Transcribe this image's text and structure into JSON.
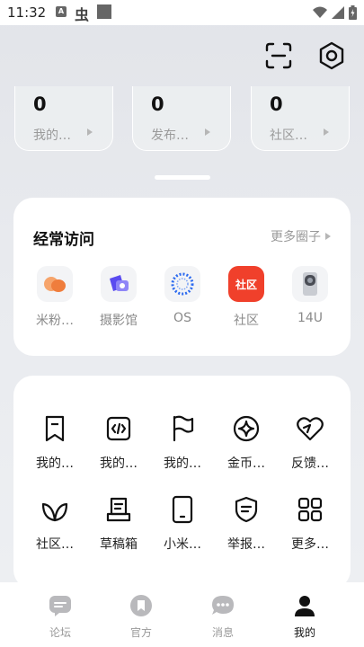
{
  "status_bar": {
    "time": "11:32",
    "badge": "A",
    "app_glyph": "虫"
  },
  "stats": [
    {
      "value": "0",
      "label": "我的…"
    },
    {
      "value": "0",
      "label": "发布…"
    },
    {
      "value": "0",
      "label": "社区…"
    }
  ],
  "frequent": {
    "title": "经常访问",
    "more": "更多圈子",
    "apps": [
      {
        "label": "米粉…",
        "icon": "fan-club-icon"
      },
      {
        "label": "摄影馆",
        "icon": "photo-gallery-icon"
      },
      {
        "label": "OS",
        "icon": "os-ring-icon"
      },
      {
        "label": "社区",
        "icon_text": "社区"
      },
      {
        "label": "14U",
        "icon": "phone-14u-icon"
      }
    ]
  },
  "tools": {
    "items": [
      {
        "label": "我的…",
        "icon": "bookmark-icon"
      },
      {
        "label": "我的…",
        "icon": "code-file-icon"
      },
      {
        "label": "我的…",
        "icon": "flag-icon"
      },
      {
        "label": "金币…",
        "icon": "coin-star-icon"
      },
      {
        "label": "反馈…",
        "icon": "heart-feedback-icon"
      },
      {
        "label": "社区…",
        "icon": "leaf-icon"
      },
      {
        "label": "草稿箱",
        "icon": "draft-box-icon"
      },
      {
        "label": "小米…",
        "icon": "tablet-icon"
      },
      {
        "label": "举报…",
        "icon": "shield-report-icon"
      },
      {
        "label": "更多…",
        "icon": "grid-more-icon"
      }
    ]
  },
  "bottom_nav": {
    "items": [
      {
        "label": "论坛",
        "icon": "forum-icon",
        "active": false
      },
      {
        "label": "官方",
        "icon": "official-icon",
        "active": false
      },
      {
        "label": "消息",
        "icon": "message-icon",
        "active": false
      },
      {
        "label": "我的",
        "icon": "profile-icon",
        "active": true
      }
    ]
  },
  "colors": {
    "accent": "#f0402b",
    "icon_dark": "#111111",
    "muted_text": "#9a9a9a"
  }
}
